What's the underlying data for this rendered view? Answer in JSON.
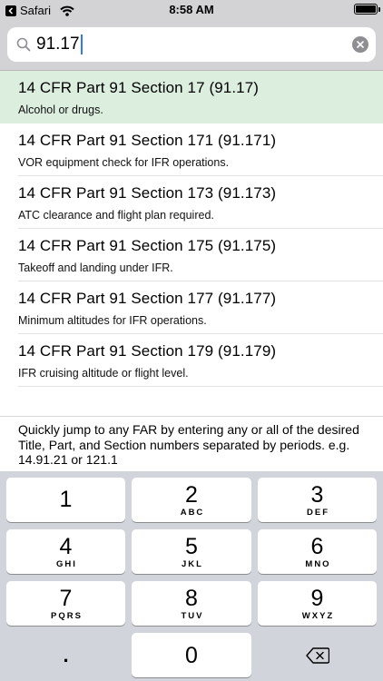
{
  "status_bar": {
    "back_app": "Safari",
    "time": "8:58 AM"
  },
  "search": {
    "value": "91.17"
  },
  "results": [
    {
      "title": "14 CFR Part 91 Section 17  (91.17)",
      "description": "Alcohol or drugs."
    },
    {
      "title": "14 CFR Part 91 Section 171  (91.171)",
      "description": "VOR equipment check for IFR operations."
    },
    {
      "title": "14 CFR Part 91 Section 173  (91.173)",
      "description": "ATC clearance and flight plan required."
    },
    {
      "title": "14 CFR Part 91 Section 175  (91.175)",
      "description": "Takeoff and landing under IFR."
    },
    {
      "title": "14 CFR Part 91 Section 177  (91.177)",
      "description": "Minimum altitudes for IFR operations."
    },
    {
      "title": "14 CFR Part 91 Section 179  (91.179)",
      "description": "IFR cruising altitude or flight level."
    }
  ],
  "help_text": "Quickly jump to any FAR by entering any or all of the desired Title, Part, and Section numbers separated by periods.  e.g. 14.91.21 or 121.1",
  "keyboard": {
    "keys": [
      {
        "num": "1",
        "letters": ""
      },
      {
        "num": "2",
        "letters": "ABC"
      },
      {
        "num": "3",
        "letters": "DEF"
      },
      {
        "num": "4",
        "letters": "GHI"
      },
      {
        "num": "5",
        "letters": "JKL"
      },
      {
        "num": "6",
        "letters": "MNO"
      },
      {
        "num": "7",
        "letters": "PQRS"
      },
      {
        "num": "8",
        "letters": "TUV"
      },
      {
        "num": "9",
        "letters": "WXYZ"
      },
      {
        "num": "0",
        "letters": ""
      }
    ],
    "dot": ".",
    "delete_icon": "backspace-icon"
  },
  "colors": {
    "selected_row": "#dcefdf",
    "caret": "#2f7bf6",
    "keyboard_bg": "#d1d4da"
  }
}
